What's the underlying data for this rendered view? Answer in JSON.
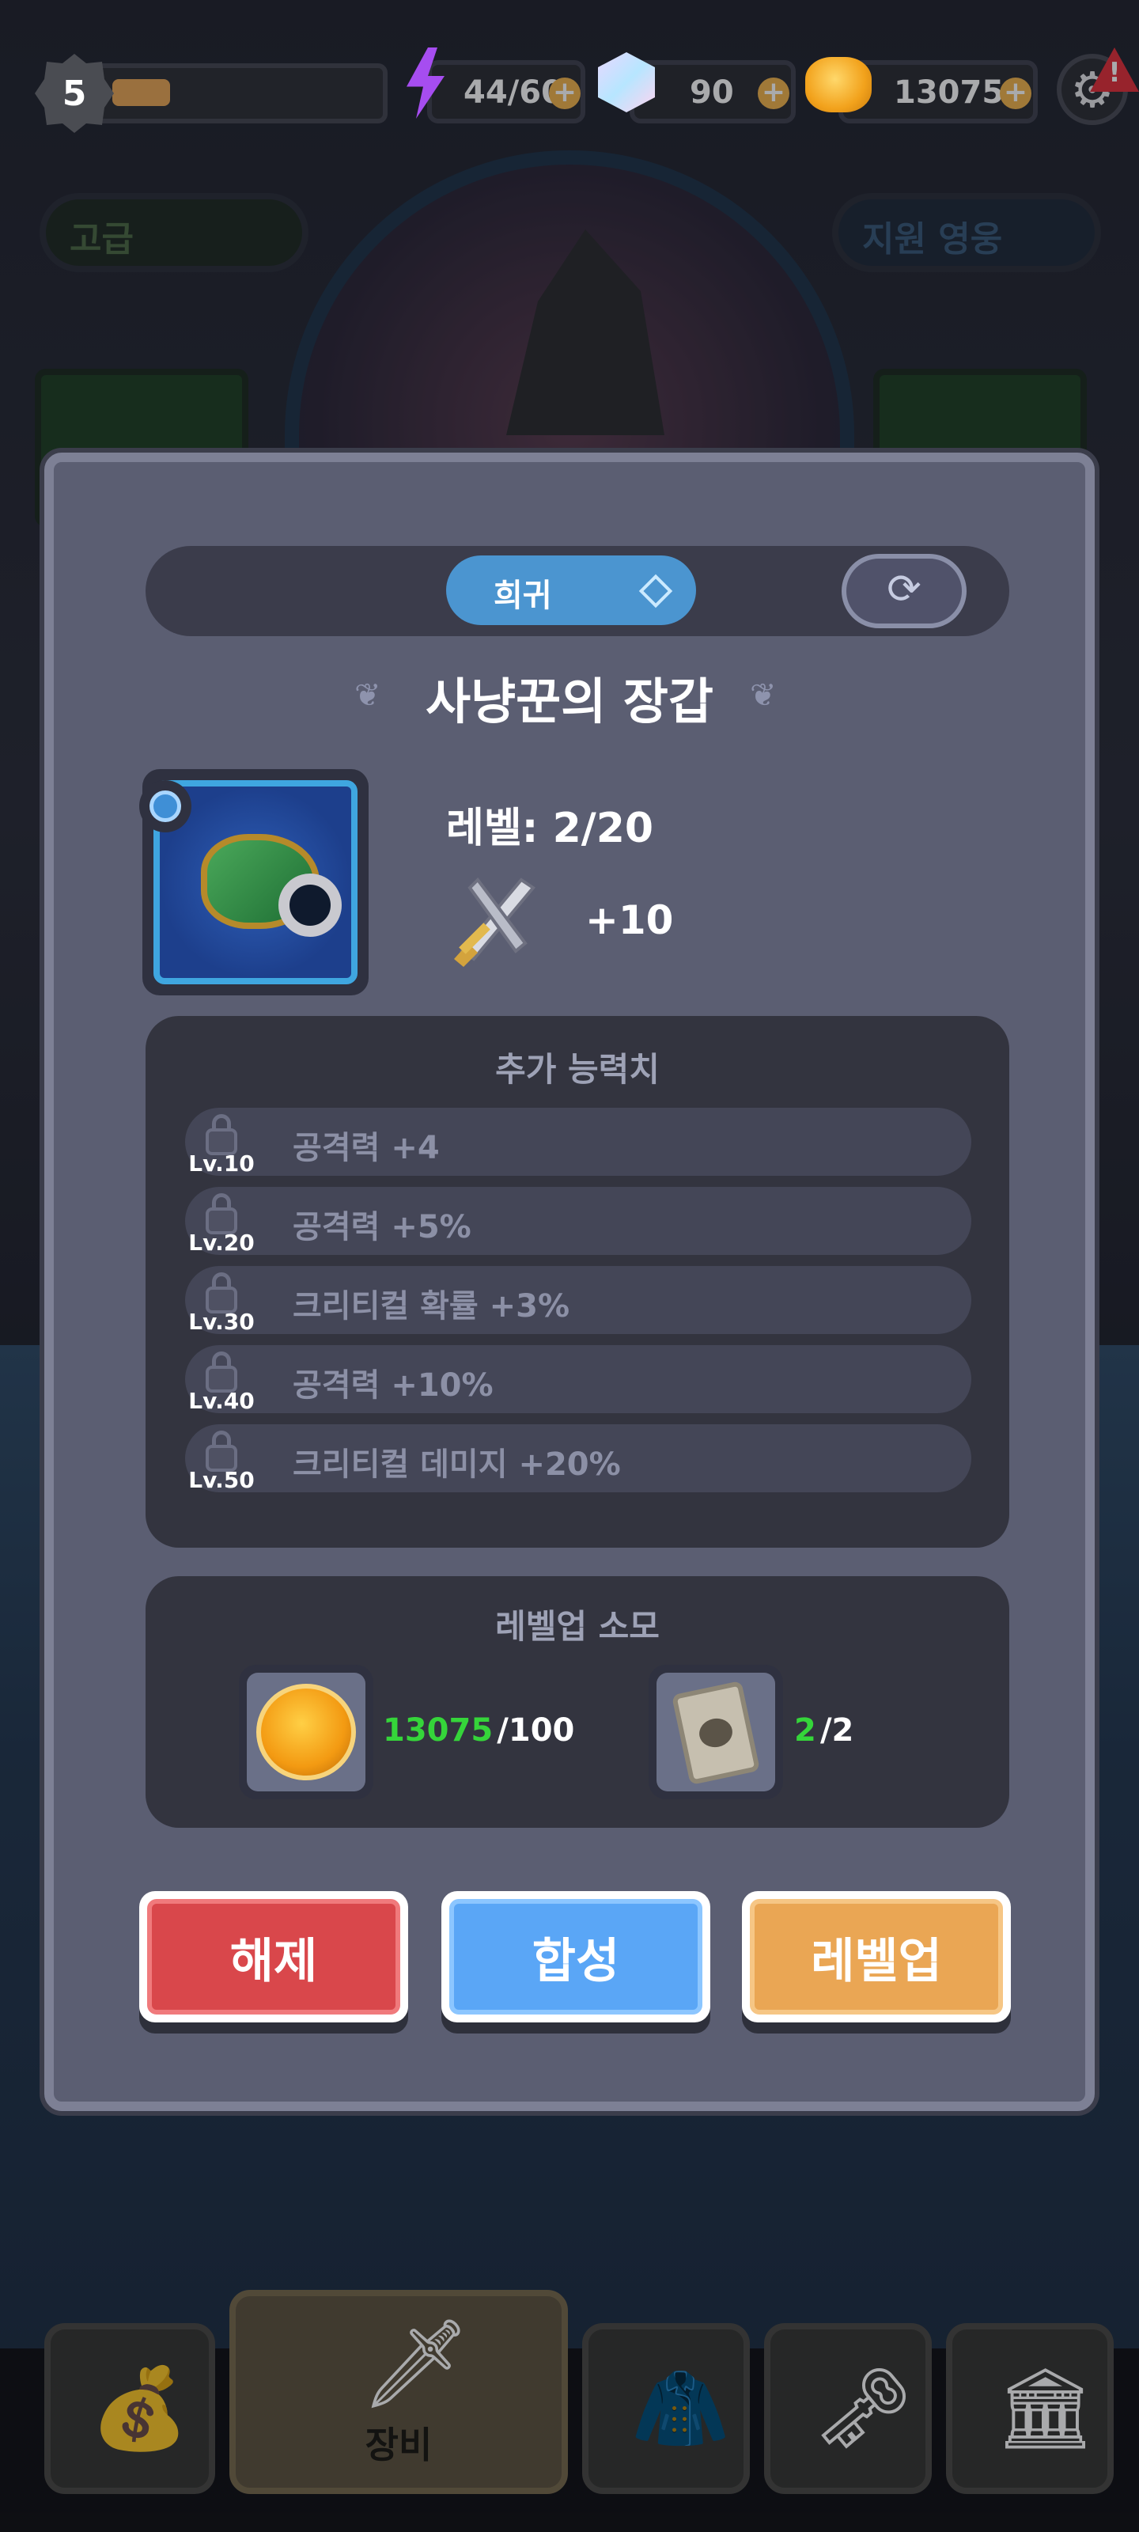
{
  "hud": {
    "player_level": "5",
    "xp_progress": 0.22,
    "energy": "44/60",
    "gems": "90",
    "gold": "13075",
    "plus_symbol": "+",
    "alert_symbol": "!"
  },
  "background": {
    "grade_label": "고급",
    "support_label": "지원 영웅"
  },
  "item": {
    "rarity": "희귀",
    "name": "사냥꾼의 장갑",
    "level_text": "레벨: 2/20",
    "attack_bonus": "+10",
    "icon": "hunter-glove-icon"
  },
  "extra_stats": {
    "title": "추가 능력치",
    "rows": [
      {
        "level": "Lv.10",
        "text": "공격력 +4"
      },
      {
        "level": "Lv.20",
        "text": "공격력 +5%"
      },
      {
        "level": "Lv.30",
        "text": "크리티컬 확률 +3%"
      },
      {
        "level": "Lv.40",
        "text": "공격력 +10%"
      },
      {
        "level": "Lv.50",
        "text": "크리티컬 데미지 +20%"
      }
    ]
  },
  "levelup_cost": {
    "title": "레벨업 소모",
    "gold": {
      "have": "13075",
      "need": "/100"
    },
    "scroll": {
      "have": "2",
      "need": "/2"
    }
  },
  "actions": {
    "unequip": "해제",
    "combine": "합성",
    "levelup": "레벨업"
  },
  "nav": {
    "equipment_label": "장비"
  },
  "colors": {
    "unequip": "#d9474b",
    "combine": "#5aa6f6",
    "levelup": "#eaa654",
    "rarity": "#4b95d0",
    "cost_ok": "#35d53a"
  }
}
